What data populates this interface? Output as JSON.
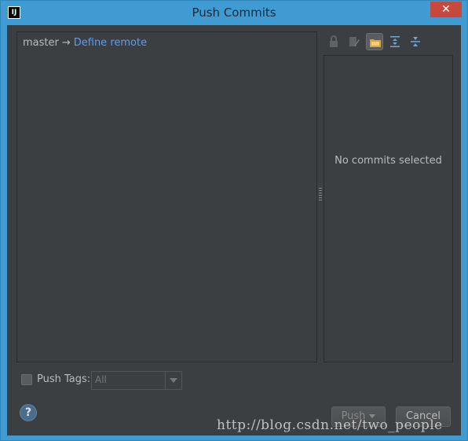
{
  "window": {
    "title": "Push Commits",
    "app_icon_text": "IJ",
    "close_glyph": "✕"
  },
  "push_tree": {
    "branch": "master",
    "arrow": "→",
    "remote_link": "Define remote"
  },
  "details_panel": {
    "empty_text": "No commits selected"
  },
  "toolbar": {
    "buttons": [
      "lock-icon",
      "edit-icon",
      "folder-icon",
      "expand-all-icon",
      "collapse-all-icon"
    ]
  },
  "options": {
    "push_tags_label": "Push Tags:",
    "push_tags_checked": false,
    "tags_combo_value": "All"
  },
  "footer": {
    "help_glyph": "?",
    "push_label": "Push",
    "cancel_label": "Cancel"
  },
  "watermark": "http://blog.csdn.net/two_people",
  "colors": {
    "background": "#3c3f41",
    "link": "#589df6",
    "titlebar": "#3f9bd1",
    "close": "#c7483d"
  }
}
